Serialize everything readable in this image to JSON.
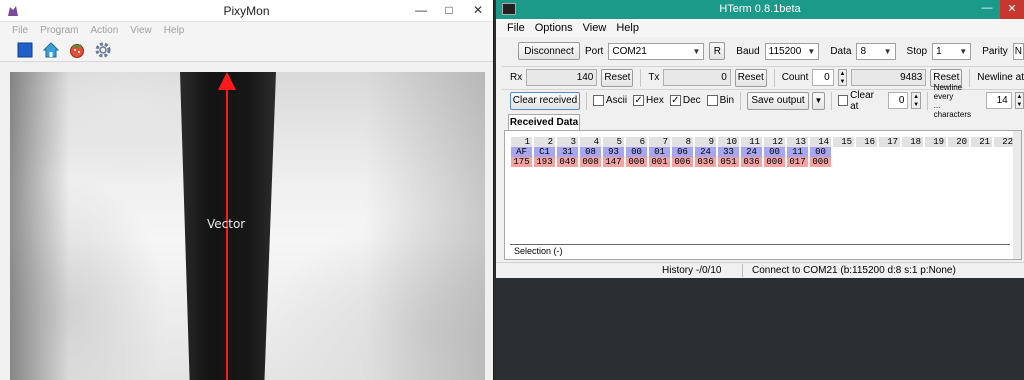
{
  "pixymon": {
    "title": "PixyMon",
    "menu": [
      "File",
      "Program",
      "Action",
      "View",
      "Help"
    ],
    "toolbar": [
      "stop-icon",
      "home-icon",
      "raspberry-icon",
      "gear-icon"
    ],
    "video": {
      "vector_label": "Vector"
    }
  },
  "hterm": {
    "title": "HTerm 0.8.1beta",
    "menu": [
      "File",
      "Options",
      "View",
      "Help"
    ],
    "connection": {
      "disconnect_label": "Disconnect",
      "port_label": "Port",
      "port_value": "COM21",
      "refresh_label": "R",
      "baud_label": "Baud",
      "baud_value": "115200",
      "data_label": "Data",
      "data_value": "8",
      "stop_label": "Stop",
      "stop_value": "1",
      "parity_label": "Parity",
      "parity_value": "N"
    },
    "counters": {
      "rx_label": "Rx",
      "rx_value": "140",
      "rx_reset": "Reset",
      "tx_label": "Tx",
      "tx_value": "0",
      "tx_reset": "Reset",
      "count_label": "Count",
      "count_value": "0",
      "count_total": "9483",
      "count_reset": "Reset",
      "newline_at_label": "Newline at"
    },
    "view": {
      "clear_received_label": "Clear received",
      "ascii_label": "Ascii",
      "ascii_checked": false,
      "hex_label": "Hex",
      "hex_checked": true,
      "dec_label": "Dec",
      "dec_checked": true,
      "bin_label": "Bin",
      "bin_checked": false,
      "save_output_label": "Save output",
      "clear_at_label": "Clear at",
      "clear_at_value": "0",
      "newline_every_label_1": "Newline every",
      "newline_every_label_2": "... characters",
      "newline_every_value": "14"
    },
    "received": {
      "tab_label": "Received Data",
      "columns": [
        "1",
        "2",
        "3",
        "4",
        "5",
        "6",
        "7",
        "8",
        "9",
        "10",
        "11",
        "12",
        "13",
        "14",
        "15",
        "16",
        "17",
        "18",
        "19",
        "20",
        "21",
        "22"
      ],
      "hex": [
        "AF",
        "C1",
        "31",
        "08",
        "93",
        "00",
        "01",
        "06",
        "24",
        "33",
        "24",
        "00",
        "11",
        "00"
      ],
      "dec": [
        "175",
        "193",
        "049",
        "008",
        "147",
        "000",
        "001",
        "006",
        "036",
        "051",
        "036",
        "000",
        "017",
        "000"
      ],
      "selection_label": "Selection (-)"
    },
    "status": {
      "history": "History -/0/10",
      "connection": "Connect to COM21 (b:115200 d:8 s:1 p:None)"
    }
  }
}
